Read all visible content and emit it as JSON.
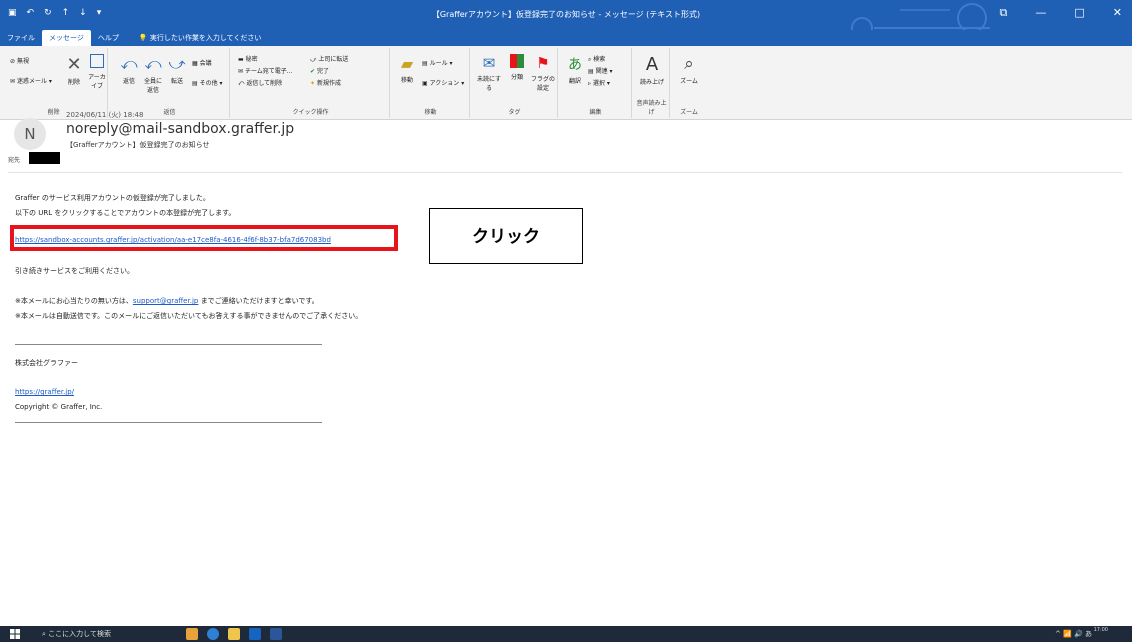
{
  "window": {
    "title": "【Grafferアカウント】仮登録完了のお知らせ - メッセージ (テキスト形式)",
    "controls": [
      "⧉",
      "—",
      "□",
      "✕"
    ]
  },
  "menu": {
    "items": [
      "ファイル",
      "メッセージ",
      "ヘルプ"
    ],
    "active": "メッセージ",
    "tell_me": "実行したい作業を入力してください"
  },
  "ribbon": {
    "groups": {
      "delete": {
        "label": "削除",
        "ignore": "無視",
        "junk": "迷惑メール",
        "delete": "削除",
        "archive": "アーカイブ"
      },
      "respond": {
        "label": "返信",
        "reply": "返信",
        "reply_all": "全員に返信",
        "forward": "転送",
        "meeting": "会議",
        "more": "その他"
      },
      "quick_steps": {
        "label": "クイック操作",
        "items": [
          "秘密",
          "チーム宛て電子...",
          "返信して削除",
          "上司に転送",
          "完了",
          "新規作成"
        ]
      },
      "move": {
        "label": "移動",
        "move": "移動",
        "rules": "ルール",
        "actions": "アクション"
      },
      "tags": {
        "label": "タグ",
        "unread": "未読にする",
        "categorize": "分類",
        "followup": "フラグの設定"
      },
      "editing": {
        "label": "編集",
        "translate": "翻訳",
        "search": "検索",
        "related": "関連",
        "select": "選択"
      },
      "speech": {
        "label": "音声読み上げ",
        "read_aloud": "読み上げ"
      },
      "zoom": {
        "label": "ズーム",
        "zoom": "ズーム"
      }
    }
  },
  "message": {
    "avatar_letter": "N",
    "date": "2024/06/11 (火) 18:48",
    "sender": "noreply@mail-sandbox.graffer.jp",
    "subject": "【Grafferアカウント】仮登録完了のお知らせ",
    "to_label": "宛先"
  },
  "body": {
    "line1": "Graffer のサービス利用アカウントの仮登録が完了しました。",
    "line2": "以下の URL をクリックすることでアカウントの本登録が完了します。",
    "activation_link": "https://sandbox-accounts.graffer.jp/activation/aa-e17ce8fa-4616-4f6f-8b37-bfa7d67083bd",
    "line3": "引き続きサービスをご利用ください。",
    "note1_prefix": "※本メールにお心当たりの無い方は、",
    "note1_link": "support@graffer.jp",
    "note1_suffix": " までご連絡いただけますと幸いです。",
    "note2": "※本メールは自動送信です。このメールにご返信いただいてもお答えする事ができませんのでご了承ください。",
    "company": "株式会社グラファー",
    "site_link": "https://graffer.jp/",
    "copyright": "Copyright © Graffer, Inc."
  },
  "annotation": {
    "callout": "クリック",
    "highlight_color": "#e8141c"
  },
  "taskbar": {
    "search_placeholder": "ここに入力して検索",
    "tray": "^ 📶 🔊 あ",
    "time": "17:00"
  },
  "colors": {
    "titlebar": "#1f5fb4",
    "link": "#1c5bc7",
    "taskbar": "#1e2a3a"
  }
}
